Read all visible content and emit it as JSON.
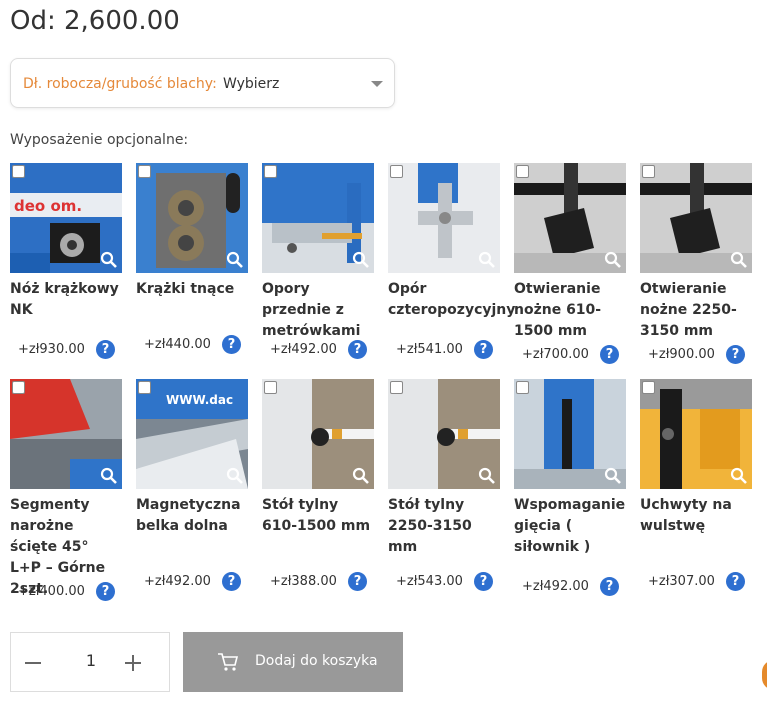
{
  "price_text": "Od: 2,600.00",
  "variant": {
    "label": "Dł. robocza/grubość blachy:",
    "value": "Wybierz"
  },
  "options_title": "Wyposażenie opcjonalne:",
  "items": [
    {
      "name": "Nóż krążkowy NK",
      "price": "+zł930.00"
    },
    {
      "name": "Krążki tnące",
      "price": "+zł440.00"
    },
    {
      "name": "Opory przednie z metrówkami",
      "price": "+zł492.00"
    },
    {
      "name": "Opór czteropozycyjny",
      "price": "+zł541.00"
    },
    {
      "name": "Otwieranie nożne 610-1500 mm",
      "price": "+zł700.00"
    },
    {
      "name": "Otwieranie nożne 2250-3150 mm",
      "price": "+zł900.00"
    },
    {
      "name": "Segmenty narożne ścięte 45° L+P – Górne 2szt.",
      "price": "+zł400.00"
    },
    {
      "name": "Magnetyczna belka dolna",
      "price": "+zł492.00"
    },
    {
      "name": "Stół tylny 610-1500 mm",
      "price": "+zł388.00"
    },
    {
      "name": "Stół tylny 2250-3150 mm",
      "price": "+zł543.00"
    },
    {
      "name": "Wspomaganie gięcia ( siłownik )",
      "price": "+zł492.00"
    },
    {
      "name": "Uchwyty na wulstwę",
      "price": "+zł307.00"
    }
  ],
  "help_glyph": "?",
  "quantity": {
    "value": "1"
  },
  "add_to_cart": {
    "label": "Dodaj do koszyka"
  },
  "colors": {
    "accent_label": "#e5893a",
    "help_badge": "#2e6fd0",
    "button_disabled": "#999999"
  }
}
